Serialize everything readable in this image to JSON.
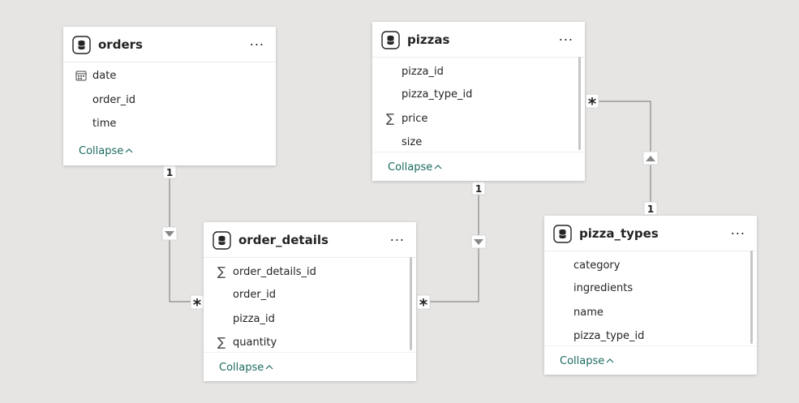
{
  "tables": {
    "orders": {
      "name": "orders",
      "more": "...",
      "fields": [
        {
          "name": "date",
          "icon": "calendar-icon"
        },
        {
          "name": "order_id",
          "icon": ""
        },
        {
          "name": "time",
          "icon": ""
        }
      ],
      "collapse": "Collapse"
    },
    "pizzas": {
      "name": "pizzas",
      "more": "...",
      "fields": [
        {
          "name": "pizza_id",
          "icon": ""
        },
        {
          "name": "pizza_type_id",
          "icon": ""
        },
        {
          "name": "price",
          "icon": "sigma-icon"
        },
        {
          "name": "size",
          "icon": ""
        }
      ],
      "collapse": "Collapse"
    },
    "order_details": {
      "name": "order_details",
      "more": "...",
      "fields": [
        {
          "name": "order_details_id",
          "icon": "sigma-icon"
        },
        {
          "name": "order_id",
          "icon": ""
        },
        {
          "name": "pizza_id",
          "icon": ""
        },
        {
          "name": "quantity",
          "icon": "sigma-icon"
        }
      ],
      "collapse": "Collapse"
    },
    "pizza_types": {
      "name": "pizza_types",
      "more": "...",
      "fields": [
        {
          "name": "category",
          "icon": ""
        },
        {
          "name": "ingredients",
          "icon": ""
        },
        {
          "name": "name",
          "icon": ""
        },
        {
          "name": "pizza_type_id",
          "icon": ""
        }
      ],
      "collapse": "Collapse"
    }
  },
  "relationships": [
    {
      "from": "orders",
      "to": "order_details",
      "from_cardinality": "1",
      "to_cardinality": "*",
      "filter_direction": "down"
    },
    {
      "from": "pizzas",
      "to": "order_details",
      "from_cardinality": "1",
      "to_cardinality": "*",
      "filter_direction": "down"
    },
    {
      "from": "pizza_types",
      "to": "pizzas",
      "from_cardinality": "1",
      "to_cardinality": "*",
      "filter_direction": "up"
    }
  ],
  "colors": {
    "canvas": "#e6e5e4",
    "card": "#ffffff",
    "line": "#8a8886",
    "collapse_text": "#1d6b60"
  }
}
